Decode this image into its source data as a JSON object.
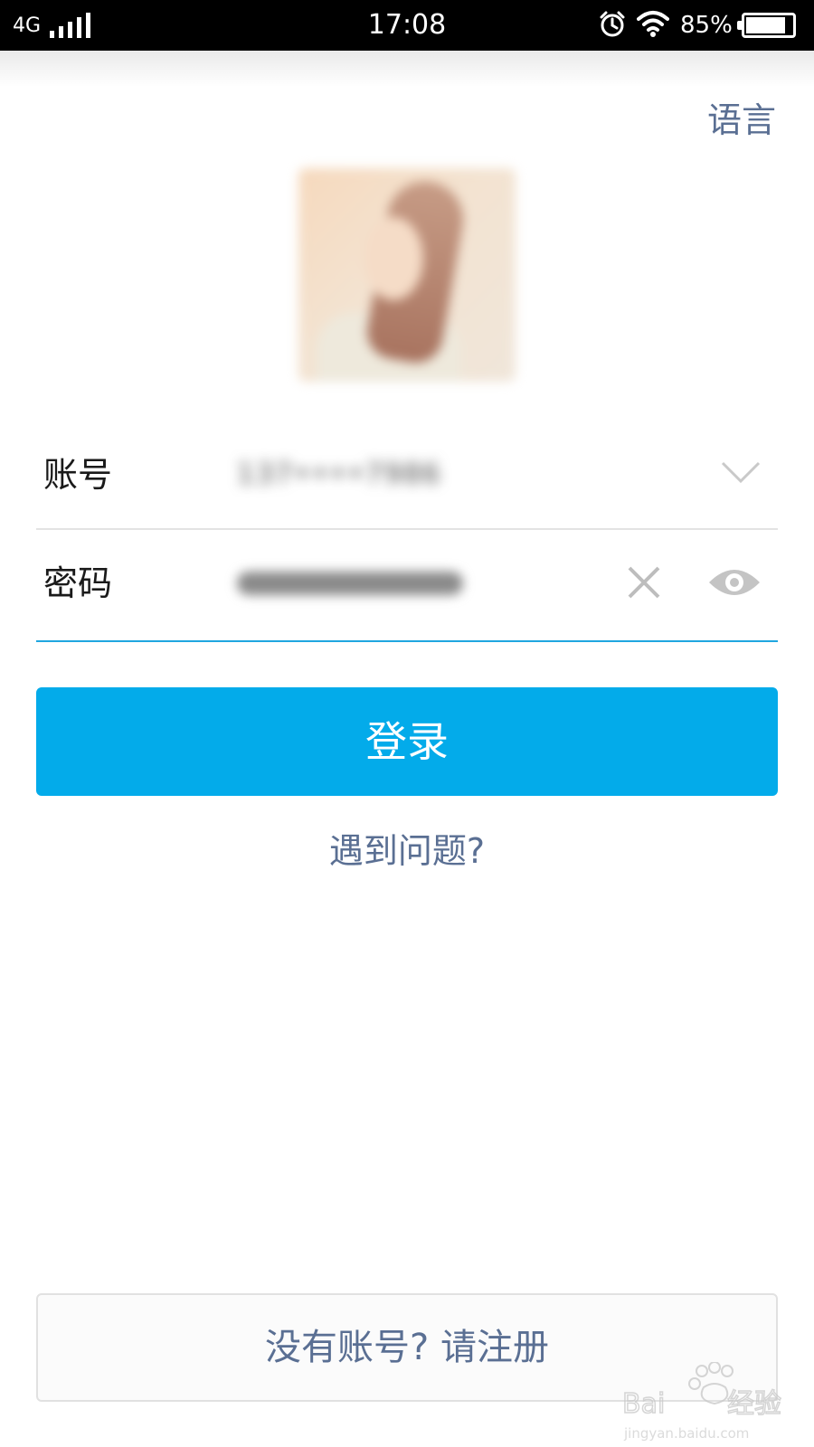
{
  "status_bar": {
    "network": "4G",
    "time": "17:08",
    "battery_percent": "85%",
    "battery_level": 0.85,
    "icons": [
      "signal-icon",
      "alarm-icon",
      "wifi-icon",
      "battery-icon"
    ]
  },
  "header": {
    "language_label": "语言"
  },
  "login_form": {
    "account_label": "账号",
    "password_label": "密码",
    "account_value_blurred": "137••••7986",
    "icons": [
      "chevron-down-icon",
      "clear-icon",
      "eye-icon"
    ]
  },
  "actions": {
    "login_label": "登录",
    "help_label": "遇到问题?",
    "register_label": "没有账号? 请注册"
  },
  "watermark": {
    "brand": "Baidu经验",
    "url": "jingyan.baidu.com"
  },
  "colors": {
    "accent": "#03abea",
    "link": "#5a6f93",
    "focus_line": "#20a6e0",
    "status_bar": "#000000"
  }
}
